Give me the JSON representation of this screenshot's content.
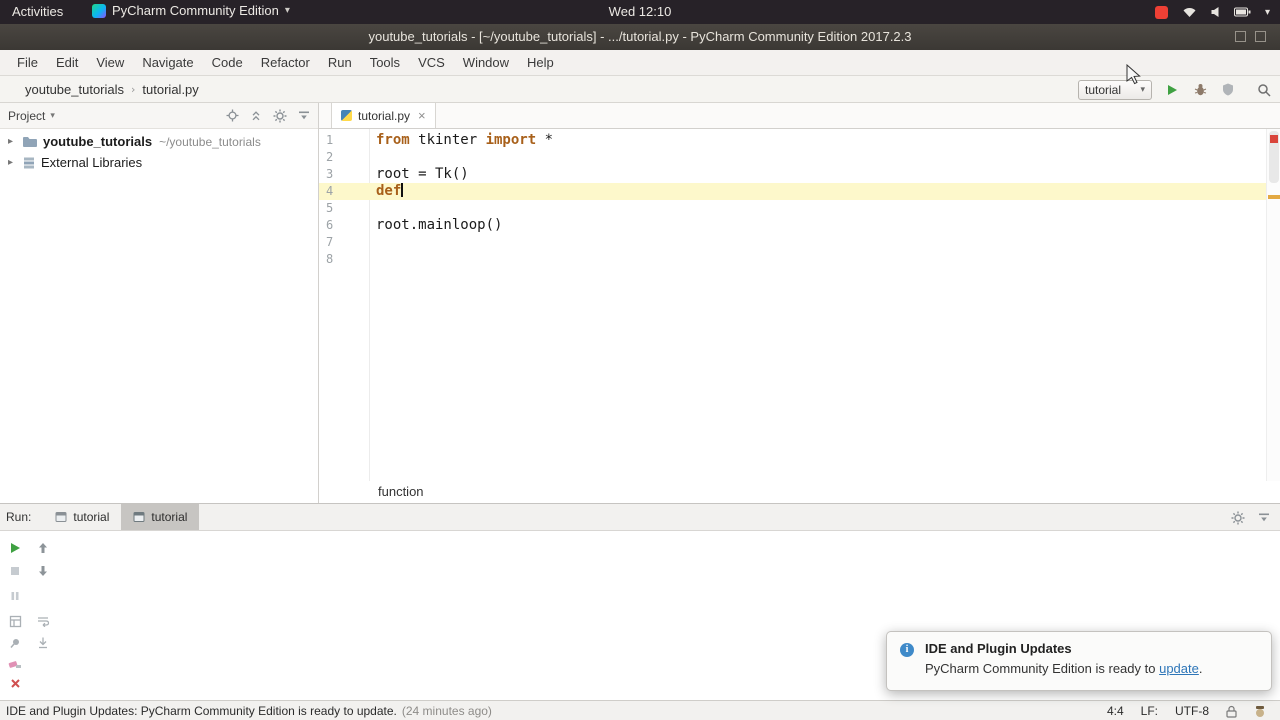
{
  "ubuntu_bar": {
    "activities": "Activities",
    "app_menu": "PyCharm Community Edition",
    "clock": "Wed 12:10"
  },
  "window": {
    "title": "youtube_tutorials - [~/youtube_tutorials] - .../tutorial.py - PyCharm Community Edition 2017.2.3"
  },
  "menu": {
    "items": [
      "File",
      "Edit",
      "View",
      "Navigate",
      "Code",
      "Refactor",
      "Run",
      "Tools",
      "VCS",
      "Window",
      "Help"
    ]
  },
  "nav": {
    "crumb_project": "youtube_tutorials",
    "crumb_file": "tutorial.py"
  },
  "toolbar": {
    "run_config": "tutorial"
  },
  "project": {
    "header": "Project",
    "root_label": "youtube_tutorials",
    "root_hint": "~/youtube_tutorials",
    "libs_label": "External Libraries"
  },
  "editor": {
    "tab_label": "tutorial.py",
    "breadcrumb": "function",
    "lines": [
      {
        "num": "1",
        "segs": [
          {
            "t": "from",
            "k": 1
          },
          {
            "t": " tkinter "
          },
          {
            "t": "import",
            "k": 1
          },
          {
            "t": " *"
          }
        ]
      },
      {
        "num": "2",
        "segs": []
      },
      {
        "num": "3",
        "segs": [
          {
            "t": "root = Tk()"
          }
        ]
      },
      {
        "num": "4",
        "segs": [
          {
            "t": "def",
            "k": 1
          }
        ],
        "caret": 1,
        "hl": 1
      },
      {
        "num": "5",
        "segs": []
      },
      {
        "num": "6",
        "segs": [
          {
            "t": "root.mainloop()"
          }
        ]
      },
      {
        "num": "7",
        "segs": []
      },
      {
        "num": "8",
        "segs": []
      }
    ]
  },
  "run": {
    "label": "Run:",
    "tabs": [
      {
        "label": "tutorial",
        "selected": false
      },
      {
        "label": "tutorial",
        "selected": true
      }
    ]
  },
  "notification": {
    "title": "IDE and Plugin Updates",
    "body": "PyCharm Community Edition is ready to ",
    "link": "update",
    "suffix": "."
  },
  "status": {
    "message": "IDE and Plugin Updates: PyCharm Community Edition is ready to update.",
    "age": "(24 minutes ago)",
    "caret_pos": "4:4",
    "line_sep": "LF:",
    "encoding": "UTF-8"
  },
  "icons": {
    "chevron_down": "▾",
    "crumb_sep": "›",
    "tree_arrow": "▸",
    "tab_close": "×"
  },
  "colors": {
    "keyword": "#a8601a",
    "caret_line": "#fdf8cb",
    "link": "#2e76b8",
    "run_green": "#3fa142",
    "error_red": "#d9453c",
    "warn_orange": "#e3a943",
    "titlebar": "#3b3834",
    "topbar": "#272228"
  }
}
